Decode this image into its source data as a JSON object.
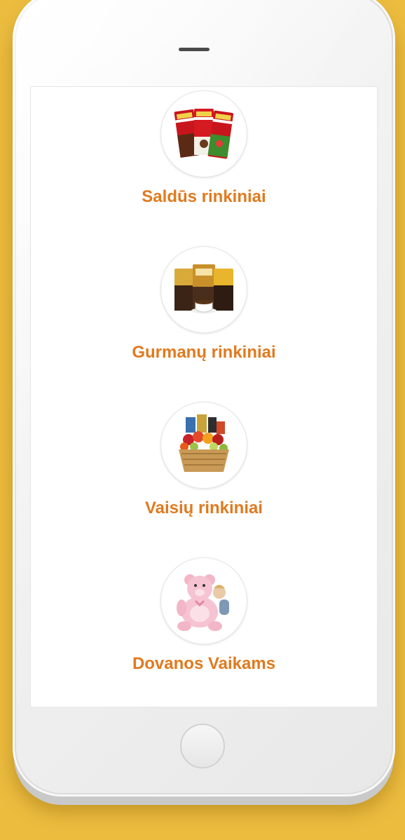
{
  "brand": {
    "accent_color": "#E07A1F",
    "background_color": "#EBBC3E"
  },
  "categories": [
    {
      "label": "Saldūs rinkiniai",
      "icon": "chocolate-bars-icon"
    },
    {
      "label": "Gurmanų rinkiniai",
      "icon": "coffee-packs-icon"
    },
    {
      "label": "Vaisių rinkiniai",
      "icon": "fruit-basket-icon"
    },
    {
      "label": "Dovanos Vaikams",
      "icon": "teddy-bear-icon"
    }
  ]
}
